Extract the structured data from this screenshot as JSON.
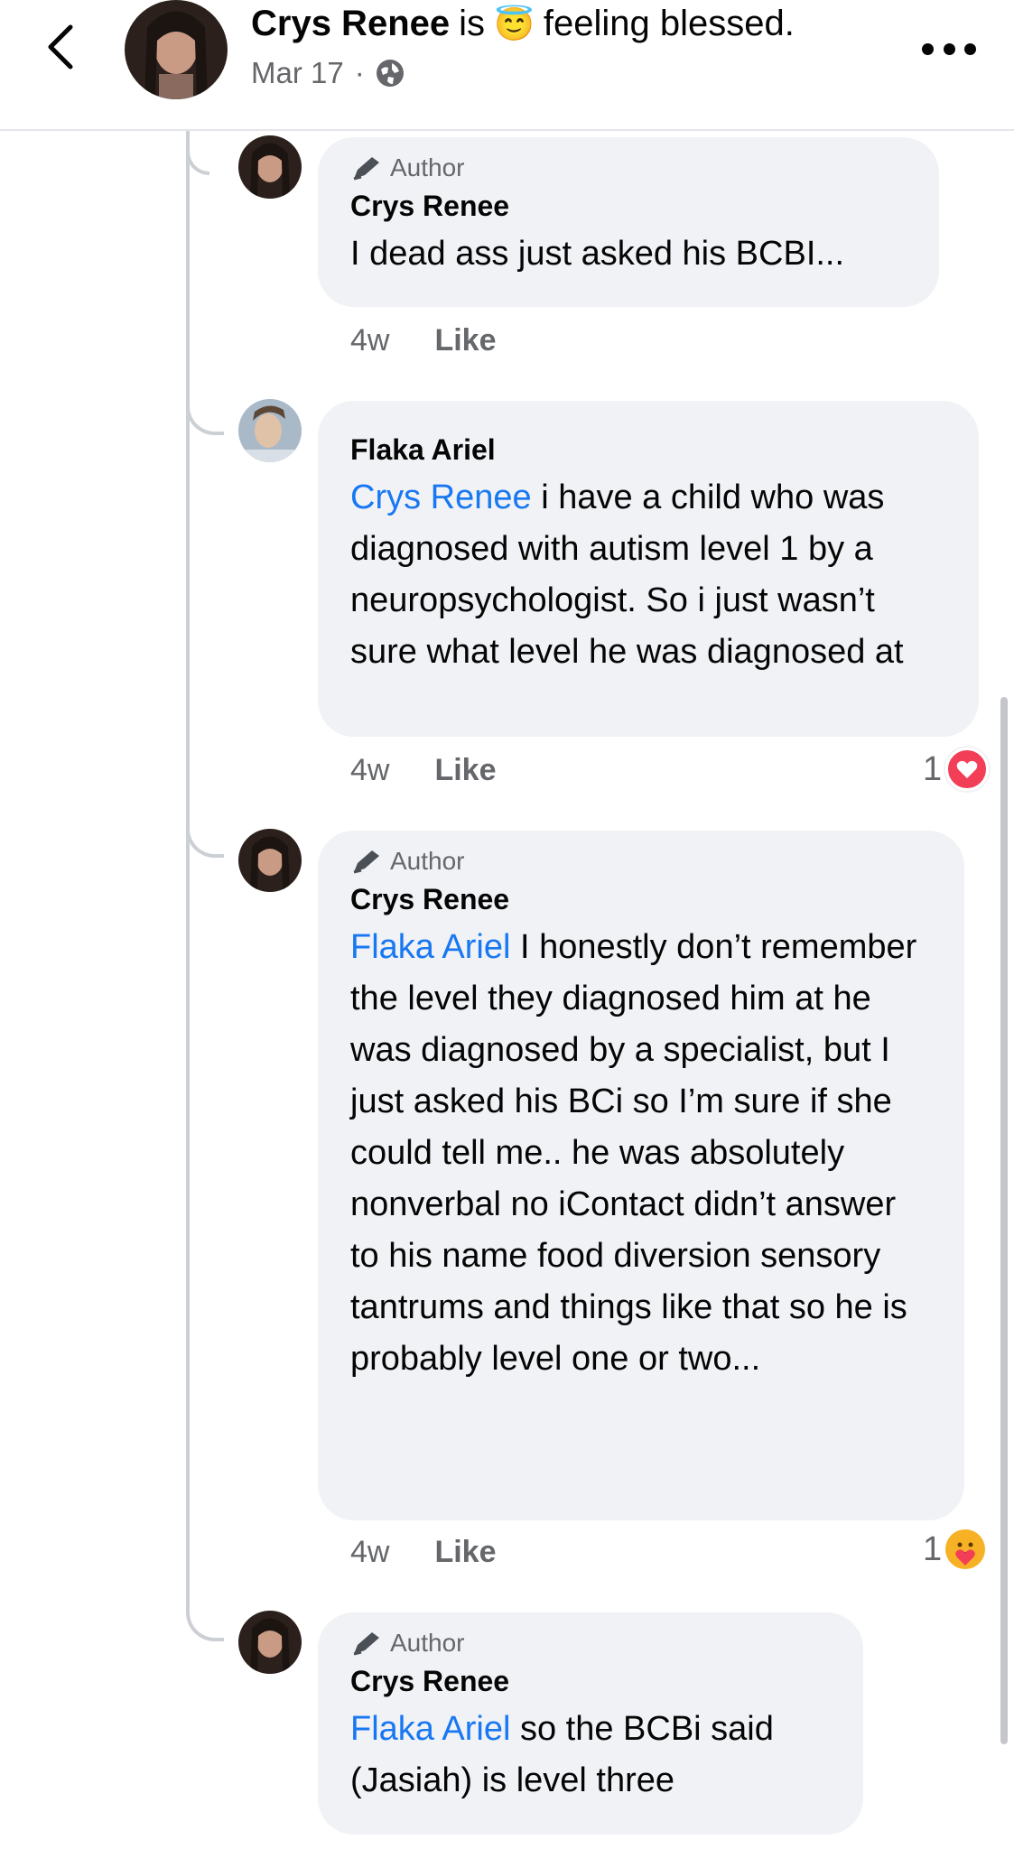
{
  "header": {
    "name": "Crys Renee",
    "is_text": "is",
    "feeling_emoji": "😇",
    "feeling": "feeling blessed.",
    "date": "Mar 17",
    "separator": "·"
  },
  "comments": [
    {
      "author_badge": "Author",
      "name": "Crys Renee",
      "mention": "",
      "text": "I dead ass just asked his BCBI...",
      "time": "4w",
      "like_label": "Like"
    },
    {
      "author_badge": "",
      "name": "Flaka Ariel",
      "mention": "Crys Renee",
      "text": " i have a child who was diagnosed with autism level 1 by a neuropsychologist. So i just wasn’t sure what level he was diagnosed at",
      "time": "4w",
      "like_label": "Like",
      "reaction_count": "1",
      "reaction": "love"
    },
    {
      "author_badge": "Author",
      "name": "Crys Renee",
      "mention": "Flaka Ariel",
      "text": " I honestly don’t remember the level they diagnosed him at he was diagnosed by a specialist, but I just asked his BCi so I’m sure if she could tell me.. he was absolutely nonverbal no iContact didn’t answer to his name food diversion sensory tantrums and things like that so he is probably level one or two...",
      "time": "4w",
      "like_label": "Like",
      "reaction_count": "1",
      "reaction": "care"
    },
    {
      "author_badge": "Author",
      "name": "Crys Renee",
      "mention": "Flaka Ariel",
      "text": " so the BCBi said (Jasiah) is level three"
    }
  ],
  "icons": {
    "back": "chevron-left-icon",
    "more": "more-icon",
    "privacy": "globe-icon",
    "author": "pencil-icon",
    "love": "heart-icon",
    "care": "care-icon"
  },
  "colors": {
    "mention": "#1877f2",
    "bubble": "#f0f2f5",
    "love": "#f33e58",
    "care": "#f7b125"
  }
}
